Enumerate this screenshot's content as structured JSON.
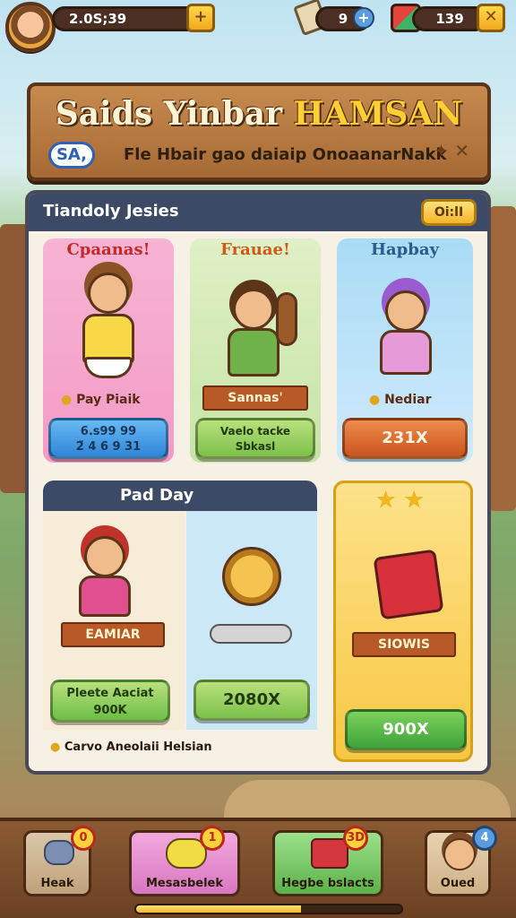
{
  "hud": {
    "coins": "2.0S;39",
    "gems": "9",
    "energy": "139"
  },
  "banner": {
    "title_part1": "Saids Yinbar",
    "title_part2": "HAMSAN",
    "subtitle": "Fle Hbair gao daiaip OnoaanarNakk",
    "badge": "SA,"
  },
  "panel": {
    "title": "Tiandoly Jesies",
    "button": "Oi:lI",
    "cards": [
      {
        "title": "Cpaanas!",
        "tag": "Pay Piaik",
        "button": "6.s99 99\n2̈ 4 6 9 31",
        "button_l1": "6.s99 99",
        "button_l2": "2̈ 4 6 9 31"
      },
      {
        "title": "Frauae!",
        "ribbon": "Sannas'",
        "button_l1": "Vaelo tacke",
        "button_l2": "Sbkasl"
      },
      {
        "title": "Hapbay",
        "tag": "Nediar",
        "button": "231X"
      }
    ],
    "section2": {
      "title": "Pad Day",
      "ribbon": "EAMIAR",
      "button1_l1": "Pleete Aaciat",
      "button1_l2": "900K",
      "button2": "2080X",
      "right_ribbon": "SIOWIS",
      "right_button": "900X",
      "footer_note": "Carvo Aneolaii Helsian"
    }
  },
  "footer": {
    "nav": [
      {
        "label": "Heak",
        "badge": "0"
      },
      {
        "label": "Mesasbelek",
        "badge": "1"
      },
      {
        "label": "Hegbe bslacts",
        "badge": "3D"
      },
      {
        "label": "Oued",
        "badge": "4"
      }
    ],
    "progress": 0.62
  },
  "colors": {
    "wood": "#a86a35",
    "panel_header": "#3d4a66",
    "blue_button": "#3a9be6",
    "green_button": "#6cc04a",
    "orange_button": "#e0712e"
  }
}
